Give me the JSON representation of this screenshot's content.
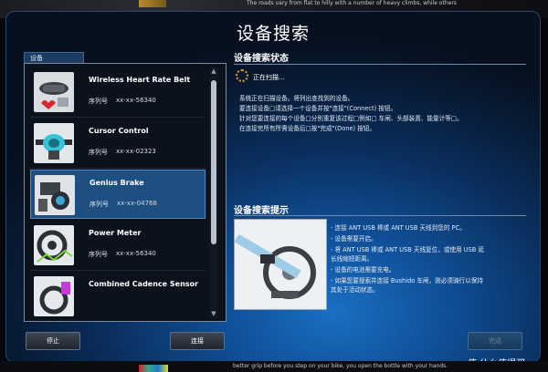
{
  "background": {
    "top_caption": "The roads vary from flat to hilly with a number of heavy climbs, while others",
    "bottom_caption": "better grip before you step on your bike, you open the bottle with your hands."
  },
  "dialog": {
    "title": "设备搜索"
  },
  "device_panel": {
    "tab_label": "设备",
    "items": [
      {
        "name": "Wireless Heart Rate Belt",
        "serial_label": "序列号",
        "serial": "xx-xx-56340",
        "selected": false
      },
      {
        "name": "Cursor Control",
        "serial_label": "序列号",
        "serial": "xx-xx-02323",
        "selected": false
      },
      {
        "name": "Genius Brake",
        "serial_label": "序列号",
        "serial": "xx-xx-04768",
        "selected": true
      },
      {
        "name": "Power Meter",
        "serial_label": "序列号",
        "serial": "xx-xx-56340",
        "selected": false
      },
      {
        "name": "Combined Cadence Sensor",
        "serial_label": "",
        "serial": "",
        "selected": false
      }
    ]
  },
  "status": {
    "title": "设备搜索状态",
    "scanning_text": "正在扫描...",
    "description_lines": [
      "系统正在扫描设备。将列出查找到的设备。",
      "要连接设备□请选择一个设备并按\"连接\"(Connect) 按钮。",
      "针对您要连接的每个设备□分别重复该过程□例如□ 车闸、头部装置、能量计等□。",
      "在连接完所有所需设备后□按\"完成\"(Done) 按钮。"
    ]
  },
  "tips": {
    "title": "设备搜索提示",
    "lines": [
      "- 连接 ANT USB 棒或 ANT USB 天线到您的 PC。",
      "- 设备需要开启。",
      "- 将 ANT USB 棒或 ANT USB 天线复位，或使用 USB 延",
      "  长线缩短距离。",
      "- 设备的电池需要充电。",
      "- 如果您要搜索并连接 Bushido 车闸，则必须骑行以保持",
      "  其处于活动状态。"
    ]
  },
  "buttons": {
    "stop": "停止",
    "connect": "连接",
    "done": "完成"
  },
  "watermark": "值 什么值得买",
  "colors": {
    "accent_orange": "#e39b2e",
    "selected_row": "#1f4f80"
  }
}
